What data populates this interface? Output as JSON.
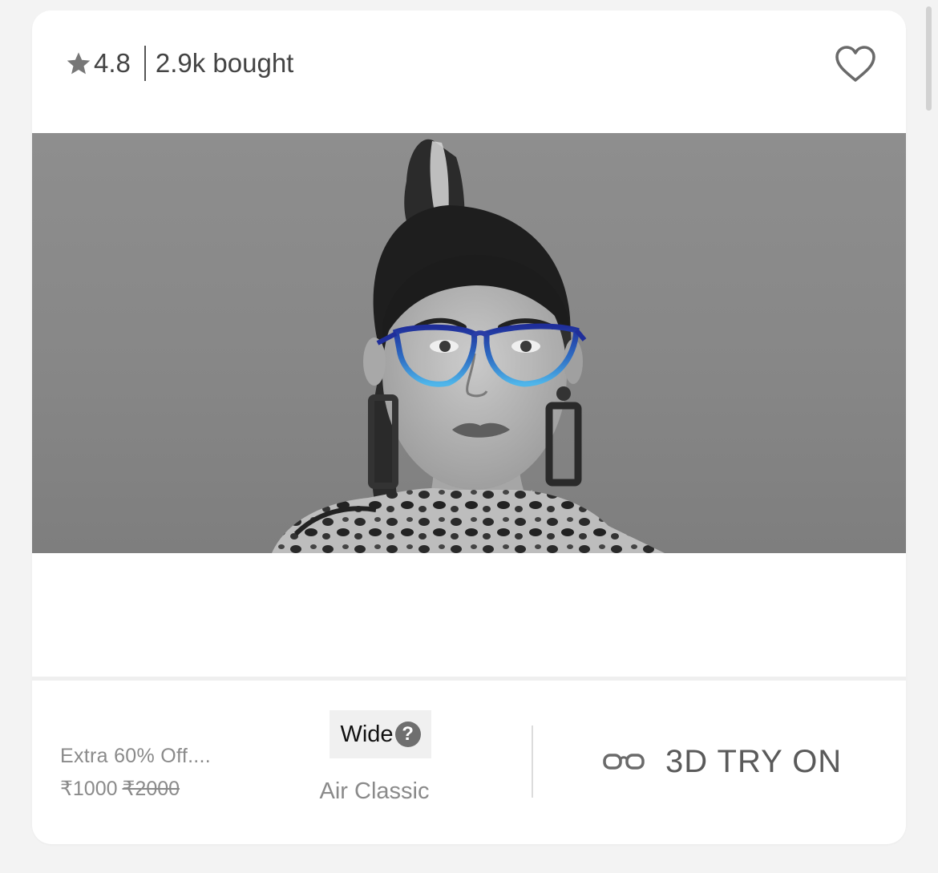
{
  "header": {
    "rating": "4.8",
    "bought": "2.9k bought"
  },
  "product": {
    "offer": "Extra 60% Off....",
    "price": "₹1000",
    "mrp": "₹2000",
    "fit": "Wide",
    "fit_help": "?",
    "collection": "Air Classic"
  },
  "actions": {
    "try_on": "3D TRY ON"
  },
  "icons": {
    "star": "star-icon",
    "wishlist": "heart-outline-icon",
    "help": "question-circle-icon",
    "try_on": "glasses-icon"
  },
  "colors": {
    "frame_top": "#1f2e9a",
    "frame_bottom": "#4fb6ea"
  }
}
